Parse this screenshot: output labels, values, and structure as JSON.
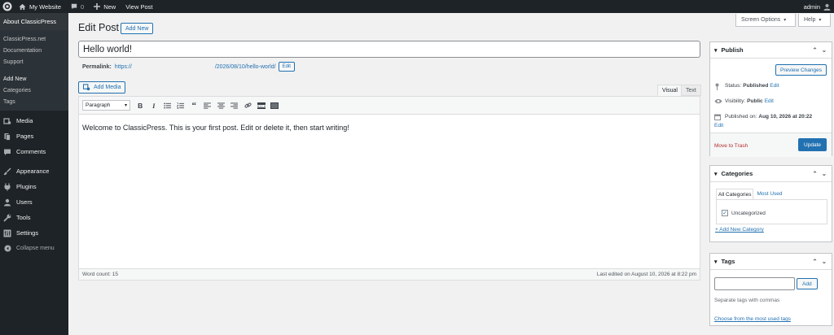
{
  "adminbar": {
    "site_name": "My Website",
    "comments_count": "0",
    "new_label": "New",
    "view_post_label": "View Post",
    "user": "admin"
  },
  "sidebar": {
    "header": "About ClassicPress",
    "links": [
      "ClassicPress.net",
      "Documentation",
      "Support"
    ],
    "post_subitems": [
      "Add New",
      "Categories",
      "Tags"
    ],
    "menu_group1": [
      "Media",
      "Pages",
      "Comments"
    ],
    "menu_group2": [
      "Appearance",
      "Plugins",
      "Users",
      "Tools",
      "Settings"
    ],
    "collapse_label": "Collapse menu"
  },
  "header": {
    "title": "Edit Post",
    "add_new_label": "Add New",
    "screen_options_label": "Screen Options",
    "help_label": "Help"
  },
  "post": {
    "title": "Hello world!",
    "permalink_label": "Permalink:",
    "permalink_prefix": "https://",
    "permalink_path": "/2026/08/10/",
    "permalink_slug": "hello-world",
    "permalink_suffix": "/",
    "permalink_edit_label": "Edit"
  },
  "editor": {
    "add_media_label": "Add Media",
    "tab_visual": "Visual",
    "tab_text": "Text",
    "format_value": "Paragraph",
    "content": "Welcome to ClassicPress. This is your first post. Edit or delete it, then start writing!",
    "word_count": "Word count: 15",
    "last_edited": "Last edited on August 10, 2026 at 8:22 pm"
  },
  "publish": {
    "title": "Publish",
    "preview_label": "Preview Changes",
    "status_label": "Status:",
    "status_value": "Published",
    "visibility_label": "Visibility:",
    "visibility_value": "Public",
    "published_label": "Published on:",
    "published_value": "Aug 10, 2026 at 20:22",
    "edit_label": "Edit",
    "trash_label": "Move to Trash",
    "update_label": "Update"
  },
  "categories": {
    "title": "Categories",
    "tab_all": "All Categories",
    "tab_used": "Most Used",
    "items": [
      {
        "label": "Uncategorized",
        "checked": true
      }
    ],
    "add_new_label": "+ Add New Category"
  },
  "tags": {
    "title": "Tags",
    "input_value": "",
    "add_label": "Add",
    "hint": "Separate tags with commas",
    "choose_label": "Choose from the most used tags"
  },
  "colors": {
    "adminbar_bg": "#1d2327",
    "accent": "#2271b1",
    "danger": "#b32d2e"
  }
}
